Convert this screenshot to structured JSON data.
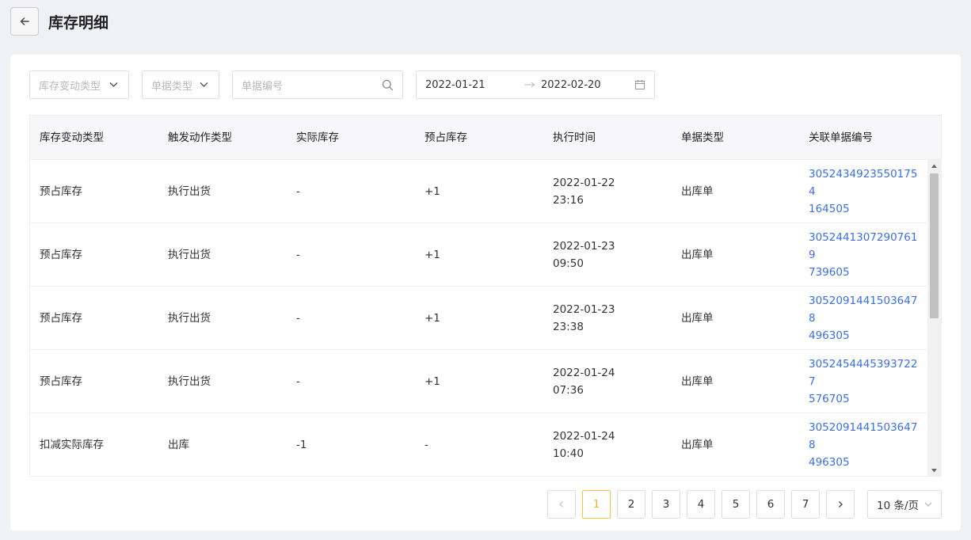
{
  "header": {
    "title": "库存明细",
    "back_icon": "arrow-left-icon"
  },
  "filters": {
    "change_type_placeholder": "库存变动类型",
    "doc_type_placeholder": "单据类型",
    "doc_no_placeholder": "单据编号",
    "date_start": "2022-01-21",
    "date_end": "2022-02-20"
  },
  "table": {
    "columns": [
      "库存变动类型",
      "触发动作类型",
      "实际库存",
      "预占库存",
      "执行时间",
      "单据类型",
      "关联单据编号"
    ],
    "rows": [
      {
        "change_type": "预占库存",
        "action": "执行出货",
        "actual": "-",
        "reserved": "+1",
        "date": "2022-01-22",
        "time": "23:16",
        "doc_type": "出库单",
        "doc_no_1": "30524349235501754",
        "doc_no_2": "164505"
      },
      {
        "change_type": "预占库存",
        "action": "执行出货",
        "actual": "-",
        "reserved": "+1",
        "date": "2022-01-23",
        "time": "09:50",
        "doc_type": "出库单",
        "doc_no_1": "30524413072907619",
        "doc_no_2": "739605"
      },
      {
        "change_type": "预占库存",
        "action": "执行出货",
        "actual": "-",
        "reserved": "+1",
        "date": "2022-01-23",
        "time": "23:38",
        "doc_type": "出库单",
        "doc_no_1": "30520914415036478",
        "doc_no_2": "496305"
      },
      {
        "change_type": "预占库存",
        "action": "执行出货",
        "actual": "-",
        "reserved": "+1",
        "date": "2022-01-24",
        "time": "07:36",
        "doc_type": "出库单",
        "doc_no_1": "30524544453937227",
        "doc_no_2": "576705"
      },
      {
        "change_type": "扣减实际库存",
        "action": "出库",
        "actual": "-1",
        "reserved": "-",
        "date": "2022-01-24",
        "time": "10:40",
        "doc_type": "出库单",
        "doc_no_1": "30520914415036478",
        "doc_no_2": "496305"
      }
    ]
  },
  "pagination": {
    "pages": [
      "1",
      "2",
      "3",
      "4",
      "5",
      "6",
      "7"
    ],
    "current": "1",
    "page_size": "10 条/页"
  },
  "colors": {
    "link": "#3b6fe6",
    "active_page": "#f3c53a"
  }
}
